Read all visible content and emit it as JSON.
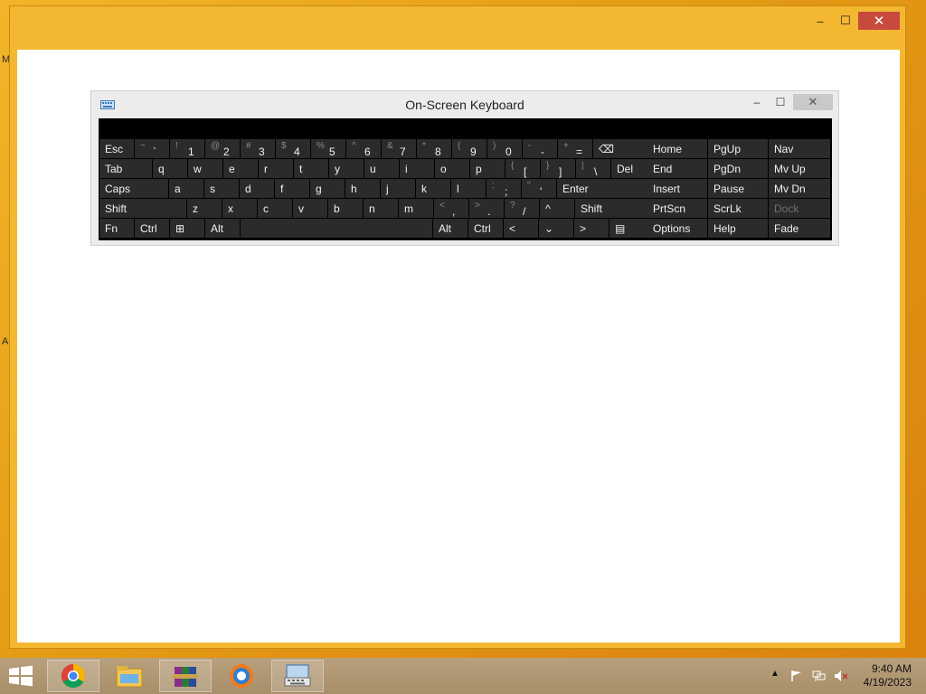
{
  "desktop": {
    "edge_letters": [
      "M",
      "A"
    ]
  },
  "outer_window": {
    "minimize": "–",
    "maximize": "☐",
    "close": "✕"
  },
  "osk": {
    "title": "On-Screen Keyboard",
    "minimize": "–",
    "maximize": "☐",
    "close": "✕",
    "rows": [
      [
        {
          "label": "Esc"
        },
        {
          "shift": "~",
          "main": "`"
        },
        {
          "shift": "!",
          "main": "1"
        },
        {
          "shift": "@",
          "main": "2"
        },
        {
          "shift": "#",
          "main": "3"
        },
        {
          "shift": "$",
          "main": "4"
        },
        {
          "shift": "%",
          "main": "5"
        },
        {
          "shift": "^",
          "main": "6"
        },
        {
          "shift": "&",
          "main": "7"
        },
        {
          "shift": "*",
          "main": "8"
        },
        {
          "shift": "(",
          "main": "9"
        },
        {
          "shift": ")",
          "main": "0"
        },
        {
          "shift": "-",
          "main": "-"
        },
        {
          "shift": "+",
          "main": "="
        },
        {
          "label": "⌫"
        }
      ],
      [
        {
          "label": "Tab"
        },
        {
          "label": "q"
        },
        {
          "label": "w"
        },
        {
          "label": "e"
        },
        {
          "label": "r"
        },
        {
          "label": "t"
        },
        {
          "label": "y"
        },
        {
          "label": "u"
        },
        {
          "label": "i"
        },
        {
          "label": "o"
        },
        {
          "label": "p"
        },
        {
          "shift": "{",
          "main": "["
        },
        {
          "shift": "}",
          "main": "]"
        },
        {
          "shift": "|",
          "main": "\\"
        },
        {
          "label": "Del"
        }
      ],
      [
        {
          "label": "Caps"
        },
        {
          "label": "a"
        },
        {
          "label": "s"
        },
        {
          "label": "d"
        },
        {
          "label": "f"
        },
        {
          "label": "g"
        },
        {
          "label": "h"
        },
        {
          "label": "j"
        },
        {
          "label": "k"
        },
        {
          "label": "l"
        },
        {
          "shift": ":",
          "main": ";"
        },
        {
          "shift": "\"",
          "main": "'"
        },
        {
          "label": "Enter"
        }
      ],
      [
        {
          "label": "Shift"
        },
        {
          "label": "z"
        },
        {
          "label": "x"
        },
        {
          "label": "c"
        },
        {
          "label": "v"
        },
        {
          "label": "b"
        },
        {
          "label": "n"
        },
        {
          "label": "m"
        },
        {
          "shift": "<",
          "main": ","
        },
        {
          "shift": ">",
          "main": "."
        },
        {
          "shift": "?",
          "main": "/"
        },
        {
          "label": "^"
        },
        {
          "label": "Shift"
        }
      ],
      [
        {
          "label": "Fn"
        },
        {
          "label": "Ctrl"
        },
        {
          "label": "⊞"
        },
        {
          "label": "Alt"
        },
        {
          "label": ""
        },
        {
          "label": "Alt"
        },
        {
          "label": "Ctrl"
        },
        {
          "label": "<"
        },
        {
          "label": "⌄"
        },
        {
          "label": ">"
        },
        {
          "label": "▤"
        }
      ]
    ],
    "nav_rows": [
      [
        "Home",
        "PgUp",
        "Nav"
      ],
      [
        "End",
        "PgDn",
        "Mv Up"
      ],
      [
        "Insert",
        "Pause",
        "Mv Dn"
      ],
      [
        "PrtScn",
        "ScrLk",
        "Dock"
      ],
      [
        "Options",
        "Help",
        "Fade"
      ]
    ]
  },
  "taskbar": {
    "pinned": [
      "chrome",
      "file-explorer",
      "winrar",
      "browser-circle",
      "on-screen-keyboard"
    ],
    "time": "9:40 AM",
    "date": "4/19/2023"
  }
}
